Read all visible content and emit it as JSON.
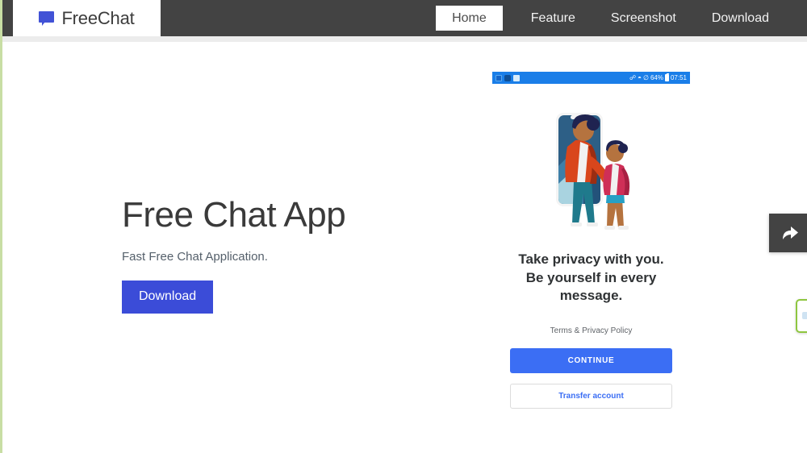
{
  "navbar": {
    "brand": {
      "name": "FreeChat",
      "icon": "chat-bubble-icon",
      "color": "#4152d6"
    },
    "items": [
      {
        "label": "Home",
        "active": true
      },
      {
        "label": "Feature",
        "active": false
      },
      {
        "label": "Screenshot",
        "active": false
      },
      {
        "label": "Download",
        "active": false
      }
    ],
    "background": "#434343"
  },
  "hero": {
    "title": "Free Chat App",
    "subtitle": "Fast Free Chat Application.",
    "button_label": "Download",
    "button_color": "#3b4cd8"
  },
  "screenshot": {
    "statusbar": {
      "left_icons": [
        "image-icon",
        "puzzle-icon",
        "twitter-icon"
      ],
      "bluetooth_icon": "bluetooth-icon",
      "wifi_icon": "wifi-icon",
      "dnd_icon": "do-not-disturb-icon",
      "battery_percent": "64%",
      "battery_icon": "battery-icon",
      "time": "07:51",
      "background": "#1a7ee8"
    },
    "illustration": "parent-and-child-with-phone-illustration",
    "headline": "Take privacy with you.\nBe yourself in every message.",
    "headline_line1": "Take privacy with you.",
    "headline_line2": "Be yourself in every",
    "headline_line3": "message.",
    "terms_link": "Terms & Privacy Policy",
    "primary_button": "CONTINUE",
    "secondary_button": "Transfer account",
    "primary_color": "#3b6ef4"
  },
  "floating": {
    "share_button_icon": "share-arrow-icon",
    "side_widget": "side-panel-peek"
  }
}
